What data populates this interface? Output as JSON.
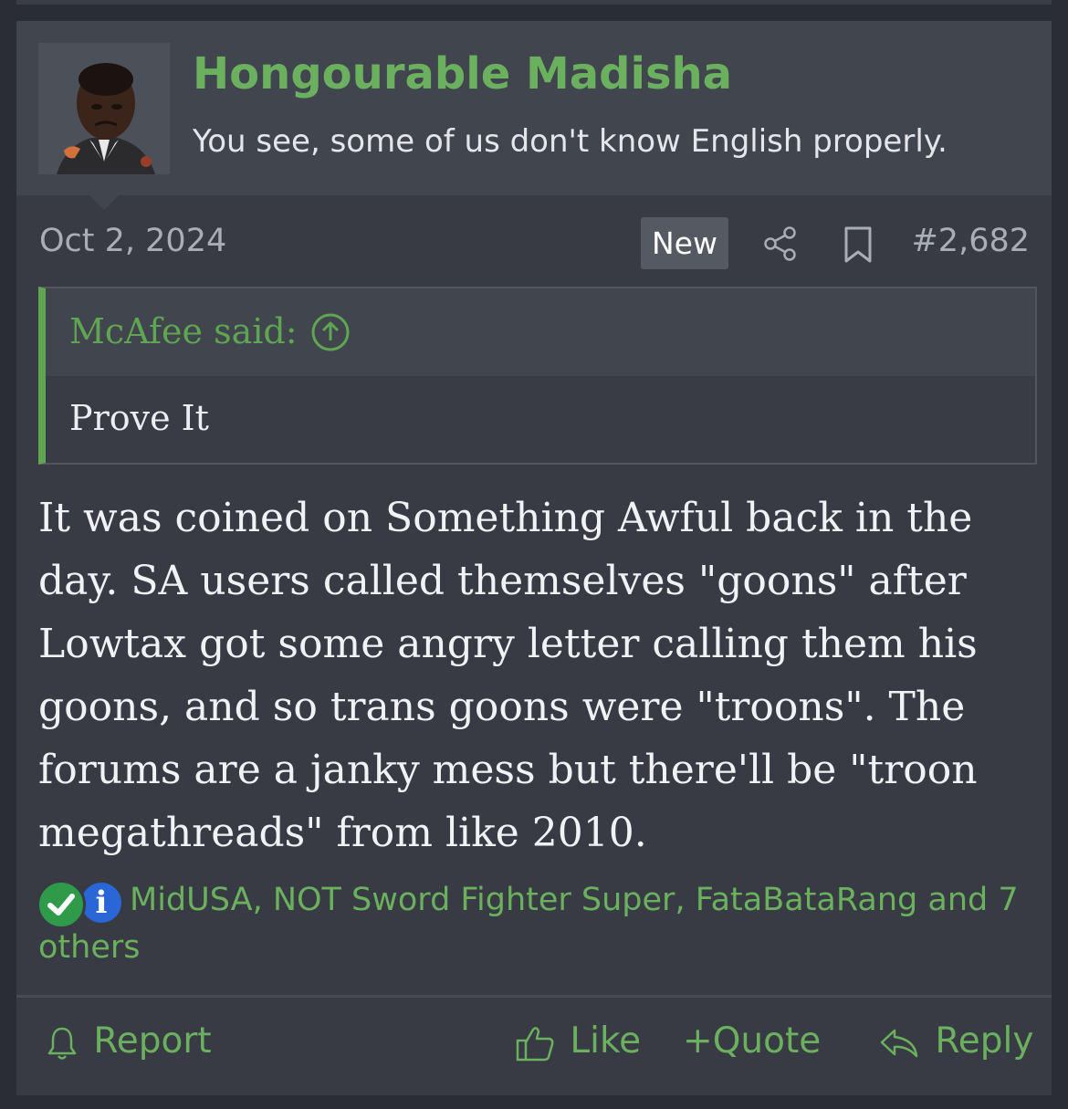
{
  "user": {
    "name": "Hongourable Madisha",
    "title": "You see, some of us don't know English properly."
  },
  "post": {
    "date": "Oct 2, 2024",
    "badge": "New",
    "number": "#2,682",
    "quote": {
      "author_line": "McAfee said:",
      "text": "Prove It"
    },
    "body": "It was coined on Something Awful back in the day. SA users called themselves \"goons\" after Lowtax got some angry letter calling them his goons, and so trans goons were \"troons\". The forums are a janky mess but there'll be \"troon megathreads\" from like 2010.",
    "reactions": {
      "icons": [
        "check-reaction-icon",
        "info-reaction-icon"
      ],
      "info_glyph": "i",
      "text": "MidUSA, NOT Sword Fighter Super, FataBataRang and 7 others"
    }
  },
  "actions": {
    "report": "Report",
    "like": "Like",
    "quote": "Quote",
    "quote_prefix": "+",
    "reply": "Reply"
  },
  "colors": {
    "accent_green": "#6bb05e",
    "panel_bg": "#383b43",
    "header_bg": "#41454e",
    "page_bg": "#2a2d33"
  }
}
